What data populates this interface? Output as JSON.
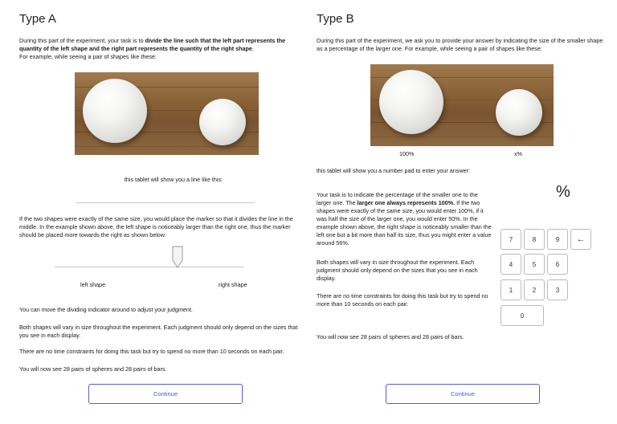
{
  "type_a": {
    "title": "Type A",
    "intro_pre": "During this part of the experiment, your task is to ",
    "intro_bold": "divide the line such that the left part represents the quantity of the left shape and the right part represents the quantity of the right shape",
    "intro_post": ".",
    "intro_example": "For example, while seeing a pair of shapes like these:",
    "tablet_line": "this tablet will show you a line like this:",
    "same_size_text": "If the two shapes were exactly of the same size, you would place the marker so that it divides the line in the middle. In the example shown above, the left shape is noticeably larger than the right one, thus the marker should be placed more towards the right as shown below:",
    "left_label": "left shape",
    "right_label": "right shape",
    "move_text": "You can move the dividing indicator around to adjust your judgment.",
    "vary_text": "Both shapes will vary in size throughout the experiment. Each judgment should only depend on the sizes that you see in each display.",
    "time_text": "There are no time constraints for doing this task but try to spend no more than 10 seconds on each pair.",
    "pairs_text": "You will now see 28 pairs of spheres and 28 pairs of bars.",
    "continue_label": "Continue",
    "marker_fraction": 0.65
  },
  "type_b": {
    "title": "Type B",
    "intro": "During this part of the experiment, we ask you to provide your answer by indicating the size of the smaller shape as a percentage of the larger one. For example, while seeing a pair of shapes like these:",
    "left_caption": "100%",
    "right_caption": "x%",
    "numpad_line": "this tablet will show you a number pad to enter your answer:",
    "task_pre": "Your task is to indicate the percentage of the smaller one to the larger one. The ",
    "task_bold": "larger one always represents 100%.",
    "task_post": " If the two shapes were exactly of the same size, you would enter 100%, if it was half the size of the larger one, you would enter 50%. In the example shown above, the right shape is noticeably smaller than the left one but a bit more than half its size, thus you might enter a value around 56%.",
    "vary_text": "Both shapes will vary in size throughout the experiment. Each judgment should only depend on the sizes that you see in each display.",
    "time_text": "There are no time constraints for doing this task but try to spend no more than 10 seconds on each pair.",
    "pairs_text": "You will now see 28 pairs of spheres and 28 pairs of bars.",
    "percent_display": "%",
    "keys": [
      "7",
      "8",
      "9",
      "←",
      "4",
      "5",
      "6",
      "1",
      "2",
      "3",
      "0"
    ],
    "continue_label": "Continue"
  },
  "colors": {
    "accent": "#4a57c4",
    "button_border": "#5560c8",
    "key_border": "#b9b9c8",
    "line": "#c8c8c8"
  }
}
